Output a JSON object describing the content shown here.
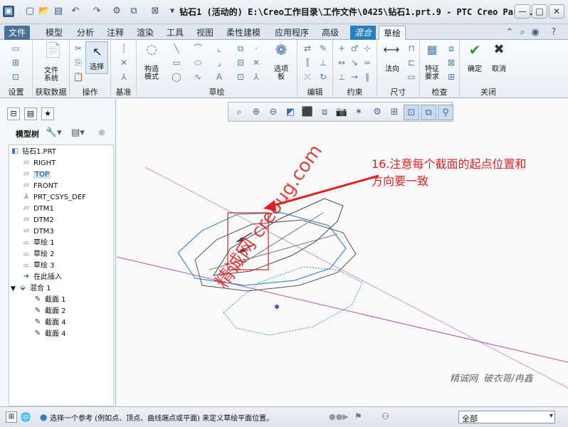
{
  "window": {
    "title": "钻石1 (活动的) E:\\Creo工作目录\\工作文件\\0425\\钻石1.prt.9 - PTC Creo Par...",
    "app_icon": "creo-logo-icon",
    "quick_access": [
      "new-icon",
      "open-icon",
      "save-icon",
      "undo-icon",
      "redo-icon",
      "regenerate-icon",
      "windows-icon",
      "close-window-icon"
    ],
    "controls": {
      "minimize": "—",
      "maximize": "□",
      "close": "✕"
    }
  },
  "ribbon_tabs": [
    {
      "label": "文件",
      "kind": "file"
    },
    {
      "label": "模型"
    },
    {
      "label": "分析"
    },
    {
      "label": "注释"
    },
    {
      "label": "渲染"
    },
    {
      "label": "工具"
    },
    {
      "label": "视图"
    },
    {
      "label": "柔性建模"
    },
    {
      "label": "应用程序"
    },
    {
      "label": "高级"
    },
    {
      "label": "混合",
      "kind": "context"
    },
    {
      "label": "草绘",
      "kind": "active"
    }
  ],
  "ribbon_groups": {
    "setup": "设置",
    "get_data": "获取数据",
    "get_data_btn": "文件\n系统",
    "operations": "操作",
    "select_btn": "选择",
    "datum": "基准",
    "construction_btn": "构造\n模式",
    "sketch": "草绘",
    "palette_btn": "选项\n板",
    "edit": "编辑",
    "constrain": "约束",
    "dimension": "尺寸",
    "normal_btn": "法向",
    "inspect": "检查",
    "feature_req_btn": "特征\n要求",
    "close": "关闭",
    "ok_btn": "确定",
    "cancel_btn": "取消"
  },
  "left_panel": {
    "header": "模型树",
    "tree": [
      {
        "label": "钻石1.PRT",
        "icon": "part-icon",
        "level": 0
      },
      {
        "label": "RIGHT",
        "icon": "datum-plane-icon",
        "level": 1
      },
      {
        "label": "TOP",
        "icon": "datum-plane-icon",
        "level": 1,
        "selected": true
      },
      {
        "label": "FRONT",
        "icon": "datum-plane-icon",
        "level": 1
      },
      {
        "label": "PRT_CSYS_DEF",
        "icon": "csys-icon",
        "level": 1
      },
      {
        "label": "DTM1",
        "icon": "datum-plane-icon",
        "level": 1
      },
      {
        "label": "DTM2",
        "icon": "datum-plane-icon",
        "level": 1
      },
      {
        "label": "DTM3",
        "icon": "datum-plane-icon",
        "level": 1
      },
      {
        "label": "草绘 1",
        "icon": "sketch-icon",
        "level": 1
      },
      {
        "label": "草绘 2",
        "icon": "sketch-icon",
        "level": 1
      },
      {
        "label": "草绘 3",
        "icon": "sketch-icon",
        "level": 1
      },
      {
        "label": "在此插入",
        "icon": "insert-arrow-icon",
        "level": 1
      },
      {
        "label": "混合 1",
        "icon": "blend-icon",
        "level": 1,
        "expanded": true
      },
      {
        "label": "截面 1",
        "icon": "section-icon",
        "level": 2
      },
      {
        "label": "截面 2",
        "icon": "section-icon",
        "level": 2
      },
      {
        "label": "截面 4",
        "icon": "section-icon",
        "level": 2
      },
      {
        "label": "截面 4",
        "icon": "section-icon",
        "level": 2
      }
    ]
  },
  "annotation": {
    "line1": "16.注意每个截面的起点位置和",
    "line2": "方向要一致",
    "color": "#e02020"
  },
  "watermark": {
    "diag_text": "精诚网 creoug.com",
    "credit": "精诚网  破衣哥/冉鑫"
  },
  "status_bar": {
    "message": "选择一个参考 (例如点、顶点、曲线端点或平面) 来定义草绘平面位置。",
    "filter": "全部"
  },
  "colors": {
    "accent": "#2a7fc1",
    "selection_box": "#e02020",
    "section_blue": "#3a8fd0",
    "axis_magenta": "#c050b0"
  }
}
